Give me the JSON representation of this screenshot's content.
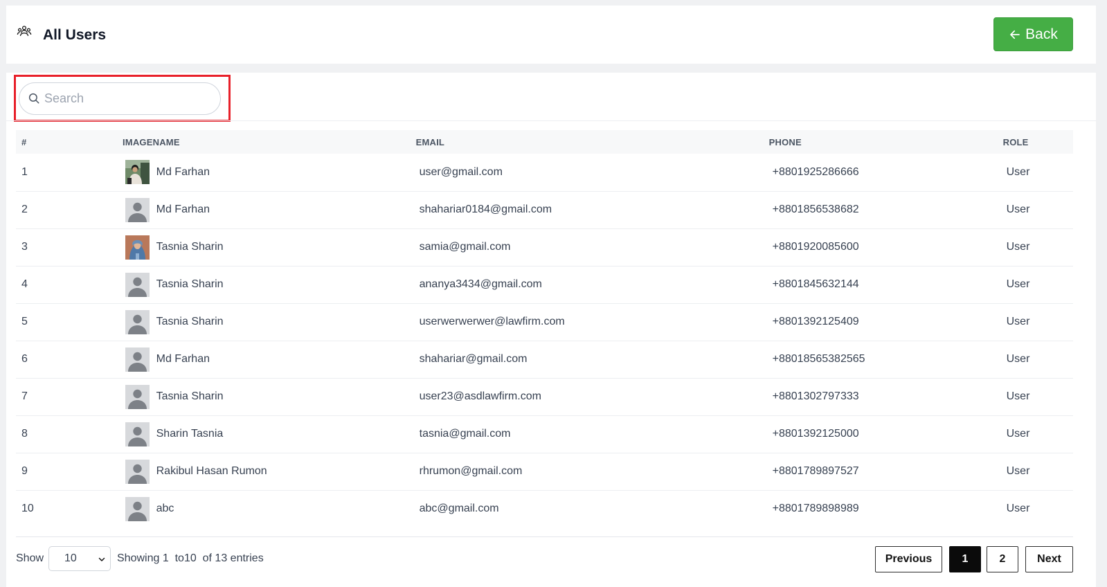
{
  "header": {
    "title": "All Users",
    "back_label": "Back",
    "back_color": "#45ae45"
  },
  "search": {
    "placeholder": "Search",
    "value": ""
  },
  "table": {
    "columns": [
      "#",
      "IMAGE",
      "NAME",
      "EMAIL",
      "PHONE",
      "ROLE"
    ],
    "rows": [
      {
        "num": "1",
        "image": "photo-male",
        "name": "Md Farhan",
        "email": "user@gmail.com",
        "phone": "+8801925286666",
        "role": "User"
      },
      {
        "num": "2",
        "image": "default-avatar",
        "name": "Md Farhan",
        "email": "shahariar0184@gmail.com",
        "phone": "+8801856538682",
        "role": "User"
      },
      {
        "num": "3",
        "image": "photo-female",
        "name": "Tasnia Sharin",
        "email": "samia@gmail.com",
        "phone": "+8801920085600",
        "role": "User"
      },
      {
        "num": "4",
        "image": "default-avatar",
        "name": "Tasnia Sharin",
        "email": "ananya3434@gmail.com",
        "phone": "+8801845632144",
        "role": "User"
      },
      {
        "num": "5",
        "image": "default-avatar",
        "name": "Tasnia Sharin",
        "email": "userwerwerwer@lawfirm.com",
        "phone": "+8801392125409",
        "role": "User"
      },
      {
        "num": "6",
        "image": "default-avatar",
        "name": "Md Farhan",
        "email": "shahariar@gmail.com",
        "phone": "+88018565382565",
        "role": "User"
      },
      {
        "num": "7",
        "image": "default-avatar",
        "name": "Tasnia Sharin",
        "email": "user23@asdlawfirm.com",
        "phone": "+8801302797333",
        "role": "User"
      },
      {
        "num": "8",
        "image": "default-avatar",
        "name": "Sharin Tasnia",
        "email": "tasnia@gmail.com",
        "phone": "+8801392125000",
        "role": "User"
      },
      {
        "num": "9",
        "image": "default-avatar",
        "name": "Rakibul Hasan Rumon",
        "email": "rhrumon@gmail.com",
        "phone": "+8801789897527",
        "role": "User"
      },
      {
        "num": "10",
        "image": "default-avatar",
        "name": "abc",
        "email": "abc@gmail.com",
        "phone": "+8801789898989",
        "role": "User"
      }
    ]
  },
  "footer": {
    "show_label": "Show",
    "page_size": "10",
    "showing_text": "Showing 1  to10  of 13 entries",
    "prev_label": "Previous",
    "pages": [
      "1",
      "2"
    ],
    "current_page": "1",
    "next_label": "Next"
  }
}
